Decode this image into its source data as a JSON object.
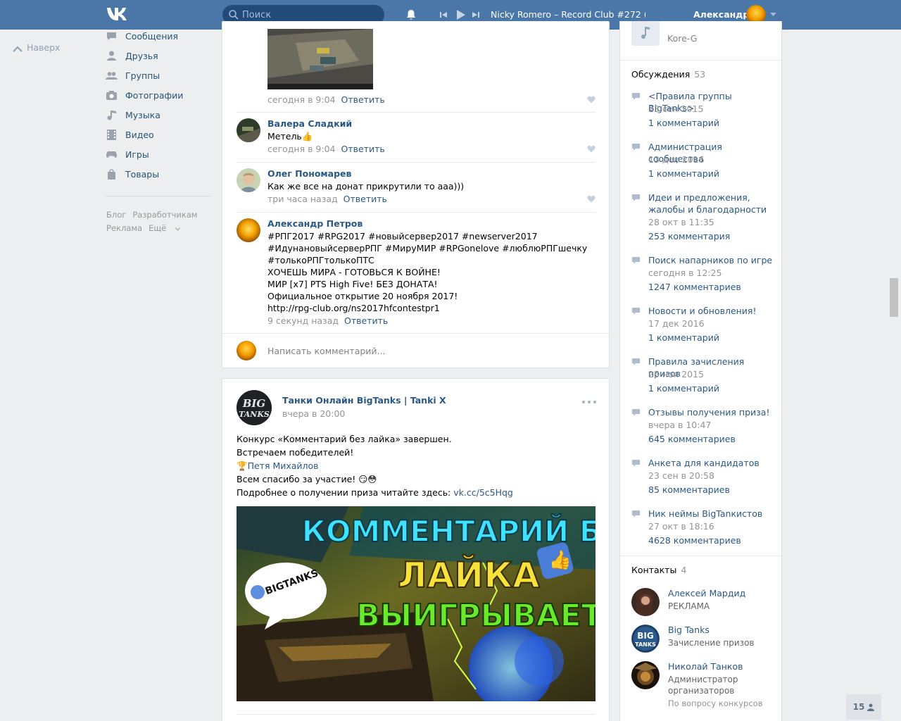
{
  "header": {
    "logo_text": "VK",
    "search_placeholder": "Поиск",
    "track_title": "Nicky Romero – Record Club #272 (...",
    "user_name": "Александр"
  },
  "left_nav": {
    "back_to_top": "Наверх",
    "items": [
      {
        "label": "Сообщения",
        "icon": "messages-icon"
      },
      {
        "label": "Друзья",
        "icon": "friends-icon"
      },
      {
        "label": "Группы",
        "icon": "groups-icon"
      },
      {
        "label": "Фотографии",
        "icon": "photos-icon"
      },
      {
        "label": "Музыка",
        "icon": "music-icon"
      },
      {
        "label": "Видео",
        "icon": "video-icon"
      },
      {
        "label": "Игры",
        "icon": "games-icon"
      },
      {
        "label": "Товары",
        "icon": "goods-icon"
      }
    ],
    "footer": {
      "blog": "Блог",
      "developers": "Разработчикам",
      "ads": "Реклама",
      "more": "Ещё"
    }
  },
  "comments": [
    {
      "meta": "сегодня в 9:04",
      "reply": "Ответить"
    },
    {
      "name": "Валера Сладкий",
      "text": "Метель👍",
      "meta": "сегодня в 9:04",
      "reply": "Ответить"
    },
    {
      "name": "Олег Пономарев",
      "text": "Как же все на донат прикрутили то ааа)))",
      "meta": "три часа назад",
      "reply": "Ответить"
    },
    {
      "name": "Александр Петров",
      "lines": [
        "#РПГ2017 #RPG2017 #новыйсервер2017 #newserver2017",
        "#ИдунановыйсерверРПГ #МируМИР #RPGonelove #люблюРПГшечку",
        "#толькоРПГтолькоПТС",
        "ХОЧЕШЬ МИРА - ГОТОВЬСЯ К ВОЙНЕ!",
        "МИР [x7] PTS High Five! БЕЗ ДОНАТА!",
        "Официальное открытие 20 ноября 2017!",
        "http://rpg-club.org/ns2017hfcontestpr1"
      ],
      "meta": "9 секунд назад",
      "reply": "Ответить"
    }
  ],
  "compose_placeholder": "Написать комментарий...",
  "post": {
    "author": "Танки Онлайн BigTanks | Tanki X",
    "time": "вчера в 20:00",
    "lines": [
      "Конкурс «Комментарий без лайка» завершен.",
      "Встречаем победителей!",
      "Всем спасибо за участие! 😏😳",
      "Подробнее о получении приза читайте здесь: "
    ],
    "winner": "Петя Михайлов",
    "link": "vk.cc/5c5Hqg",
    "image_text": {
      "line1": "КОММЕНТАРИЙ БЕЗ",
      "line2": "ЛАЙКА",
      "line3": "ВЫИГРЫВАЕТ",
      "bubble": "BIGTANKS"
    },
    "avatar_text": "BIG TANKS"
  },
  "right": {
    "audio_artist": "Kore-G",
    "discussions_title": "Обсуждения",
    "discussions_count": "53",
    "topics": [
      {
        "title": "<Правила группы BigTanks>",
        "date": "23 сен 2015",
        "count": "1 комментарий"
      },
      {
        "title": "Администрация сообщества",
        "date": "13 дек 2016",
        "count": "1 комментарий"
      },
      {
        "title": "Идеи и предложения, жалобы и благодарности",
        "date": "28 окт в 11:35",
        "count": "253 комментария"
      },
      {
        "title": "Поиск напарников по игре",
        "date": "сегодня в 12:25",
        "count": "1247 комментариев"
      },
      {
        "title": "Новости и обновления!",
        "date": "17 дек 2016",
        "count": "1 комментарий"
      },
      {
        "title": "Правила зачисления призов",
        "date": "25 ноя 2015",
        "count": "1 комментарий"
      },
      {
        "title": "Отзывы получения приза!",
        "date": "вчера в 10:47",
        "count": "645 комментариев"
      },
      {
        "title": "Анкета для кандидатов",
        "date": "23 сен в 20:58",
        "count": "85 комментариев"
      },
      {
        "title": "Ник неймы BigTanкистов",
        "date": "27 окт в 18:16",
        "count": "4628 комментариев"
      }
    ],
    "contacts_title": "Контакты",
    "contacts_count": "4",
    "contacts": [
      {
        "name": "Алексей Мардид",
        "role": "РЕКЛАМА"
      },
      {
        "name": "Big Tanks",
        "role": "Зачисление призов"
      },
      {
        "name": "Николай Танков",
        "role": "Администратор организаторов",
        "extra": "По вопросу конкурсов"
      }
    ]
  },
  "online_count": "15"
}
